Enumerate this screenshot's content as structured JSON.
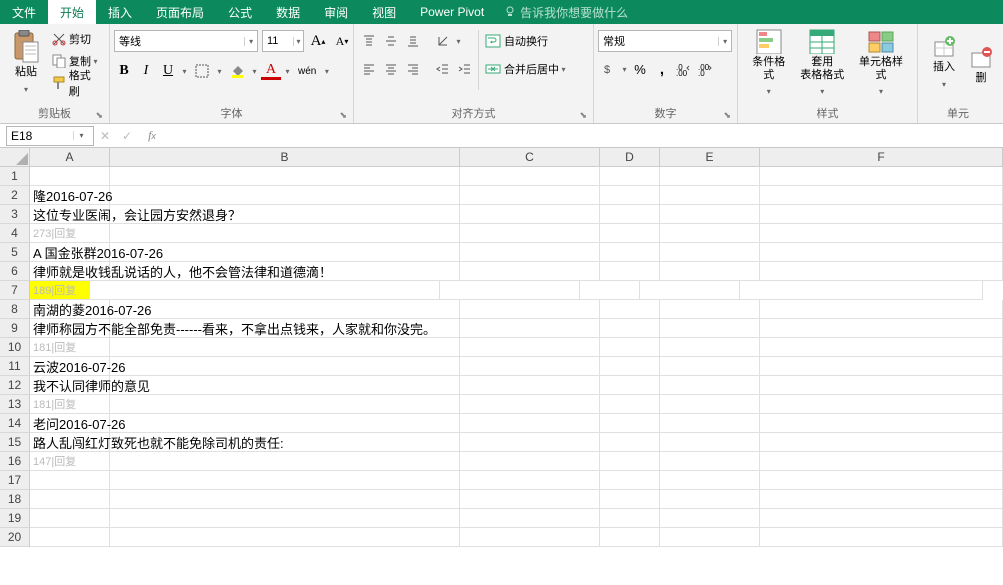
{
  "tabs": {
    "file": "文件",
    "start": "开始",
    "insert": "插入",
    "layout": "页面布局",
    "formula": "公式",
    "data": "数据",
    "review": "审阅",
    "view": "视图",
    "powerpivot": "Power Pivot",
    "tellme": "告诉我你想要做什么"
  },
  "clipboard": {
    "group": "剪贴板",
    "paste": "粘贴",
    "cut": "剪切",
    "copy": "复制",
    "painter": "格式刷"
  },
  "font": {
    "group": "字体",
    "name": "等线",
    "size": "11",
    "increase": "A",
    "decrease": "A",
    "bold": "B",
    "italic": "I",
    "underline": "U",
    "ruby": "wén"
  },
  "align": {
    "group": "对齐方式",
    "wrap": "自动换行",
    "merge": "合并后居中"
  },
  "number": {
    "group": "数字",
    "format": "常规"
  },
  "styles": {
    "group": "样式",
    "cond": "条件格式",
    "tablefmt": "套用\n表格格式",
    "cellstyle": "单元格样式"
  },
  "cells": {
    "group": "单元",
    "insert": "插入",
    "delete": "删"
  },
  "namebox": "E18",
  "cols": {
    "A": "A",
    "B": "B",
    "C": "C",
    "D": "D",
    "E": "E",
    "F": "F"
  },
  "rows": {
    "2": "隆2016-07-26",
    "3": "这位专业医闹，会让园方安然退身？",
    "4": "273|回复",
    "5": "A 国金张群2016-07-26",
    "6": "律师就是收钱乱说话的人，他不会管法律和道德滴！",
    "7": "189|回复",
    "8": "南湖的菱2016-07-26",
    "9": "律师称园方不能全部免责------看来，不拿出点钱来，人家就和你没完。",
    "10": "181|回复",
    "11": "云波2016-07-26",
    "12": "我不认同律师的意见",
    "13": "181|回复",
    "14": "老问2016-07-26",
    "15": "路人乱闯红灯致死也就不能免除司机的责任:",
    "16": "147|回复"
  }
}
